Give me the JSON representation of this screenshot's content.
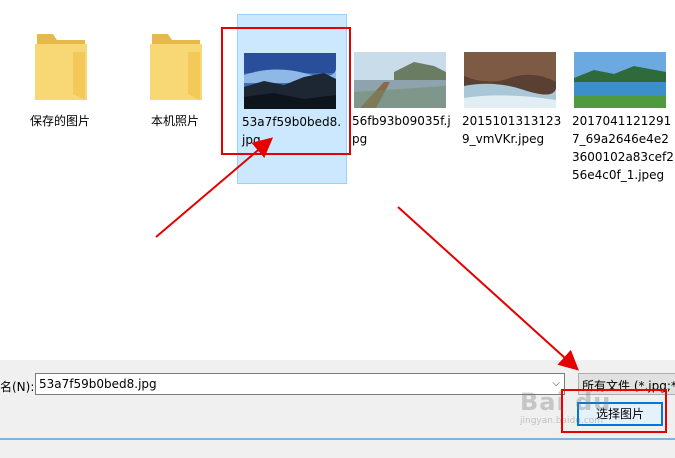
{
  "files": [
    {
      "type": "folder",
      "name": "保存的图片"
    },
    {
      "type": "folder",
      "name": "本机照片"
    },
    {
      "type": "image",
      "name": "53a7f59b0bed8.jpg",
      "selected": true,
      "thumb": "sky-lake"
    },
    {
      "type": "image",
      "name": "56fb93b09035f.jpg",
      "thumb": "boardwalk"
    },
    {
      "type": "image",
      "name": "20151013131239_vmVKr.jpeg",
      "thumb": "cave-shore"
    },
    {
      "type": "image",
      "name": "20170411212917_69a2646e4e23600102a83cef256e4c0f_1.jpeg",
      "thumb": "lake-trees"
    }
  ],
  "bottom": {
    "filename_label": "名(N):",
    "filename_value": "53a7f59b0bed8.jpg",
    "filter_value": "所有文件 (*.jpg;*.",
    "select_button": "选择图片"
  },
  "watermark": {
    "text": "Bai du",
    "sub": "jingyan.baidu.com"
  },
  "colors": {
    "selection_bg": "#cce8ff",
    "annotation_red": "#e60000",
    "folder_yellow": "#f8d775"
  }
}
